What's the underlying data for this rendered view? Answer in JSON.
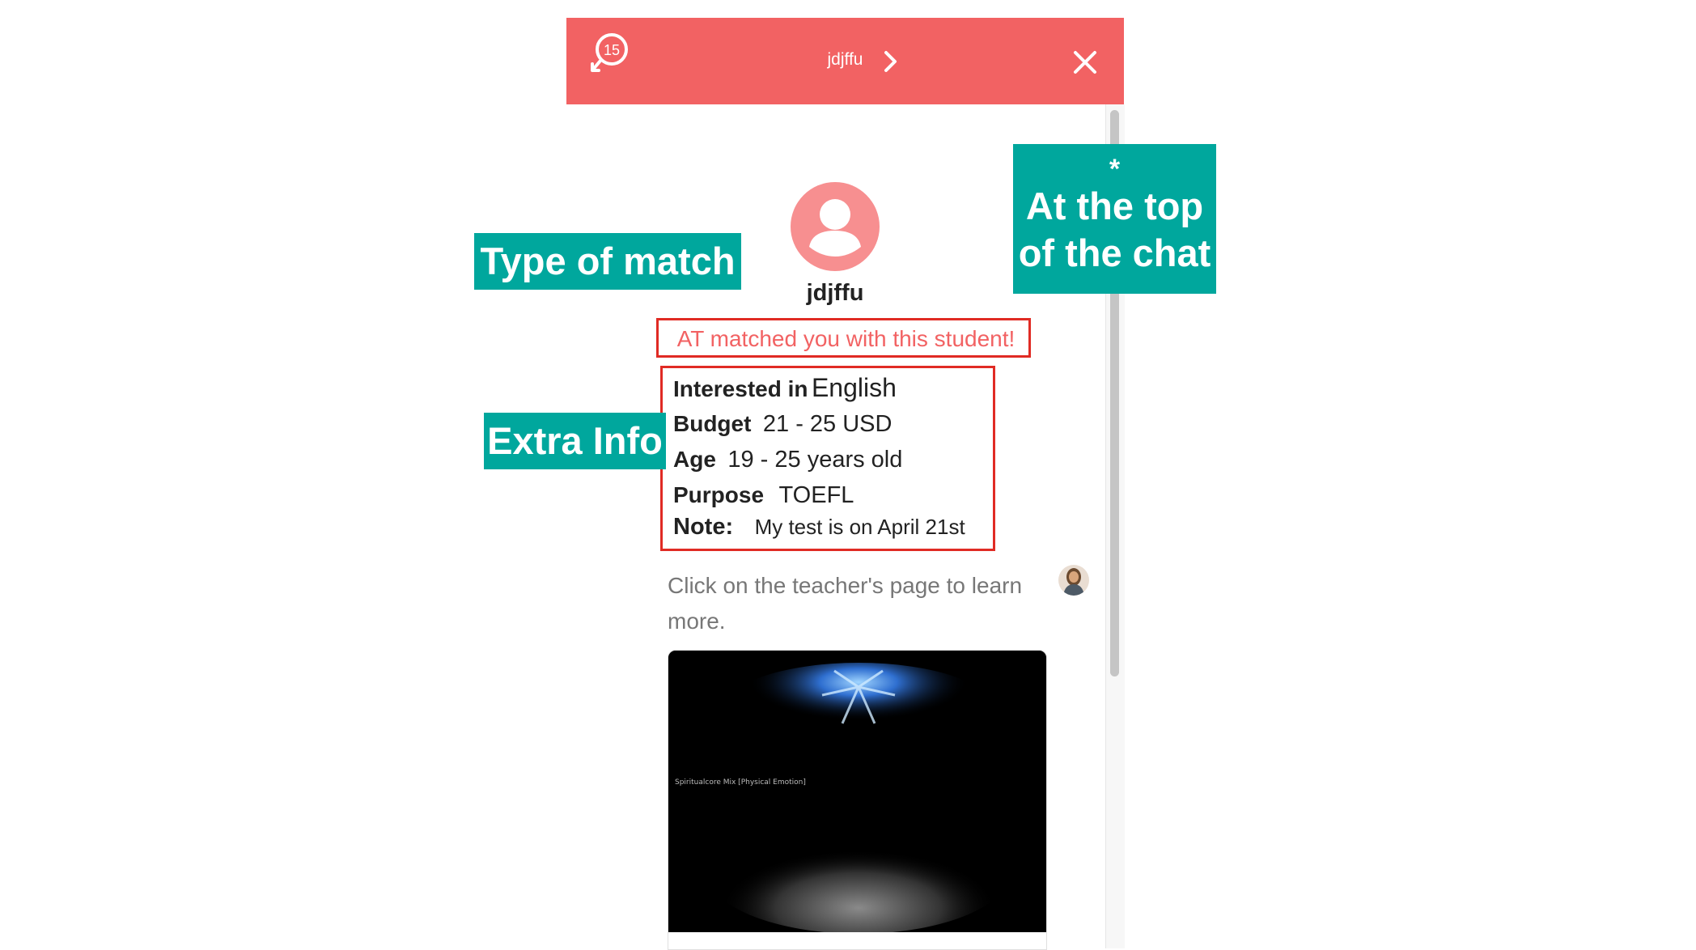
{
  "header": {
    "history_badge": "15",
    "contact_name": "jdjffu",
    "colors": {
      "bar": "#f26263"
    },
    "icons": [
      "history-icon",
      "chevron-right-icon",
      "close-icon"
    ]
  },
  "profile": {
    "username": "jdjffu",
    "match_message": "AT matched you with this student!"
  },
  "extra_info": {
    "interested_label": "Interested in",
    "interested_value": "English",
    "budget_label": "Budget",
    "budget_value": "21 - 25 USD",
    "age_label": "Age",
    "age_value": "19 - 25 years old",
    "purpose_label": "Purpose",
    "purpose_value": "TOEFL",
    "note_label": "Note:",
    "note_value": "My test is on April 21st"
  },
  "message": {
    "line1": "Click on the teacher's page to learn",
    "line2": "more."
  },
  "video": {
    "caption": "Spiritualcore Mix [Physical Emotion]"
  },
  "annotations": {
    "type_of_match": "Type of match",
    "extra_info": "Extra Info",
    "top_star": "*",
    "top_line1": "At the top",
    "top_line2": "of the chat",
    "color": "#00a79d",
    "highlight_color": "#e02b24"
  }
}
